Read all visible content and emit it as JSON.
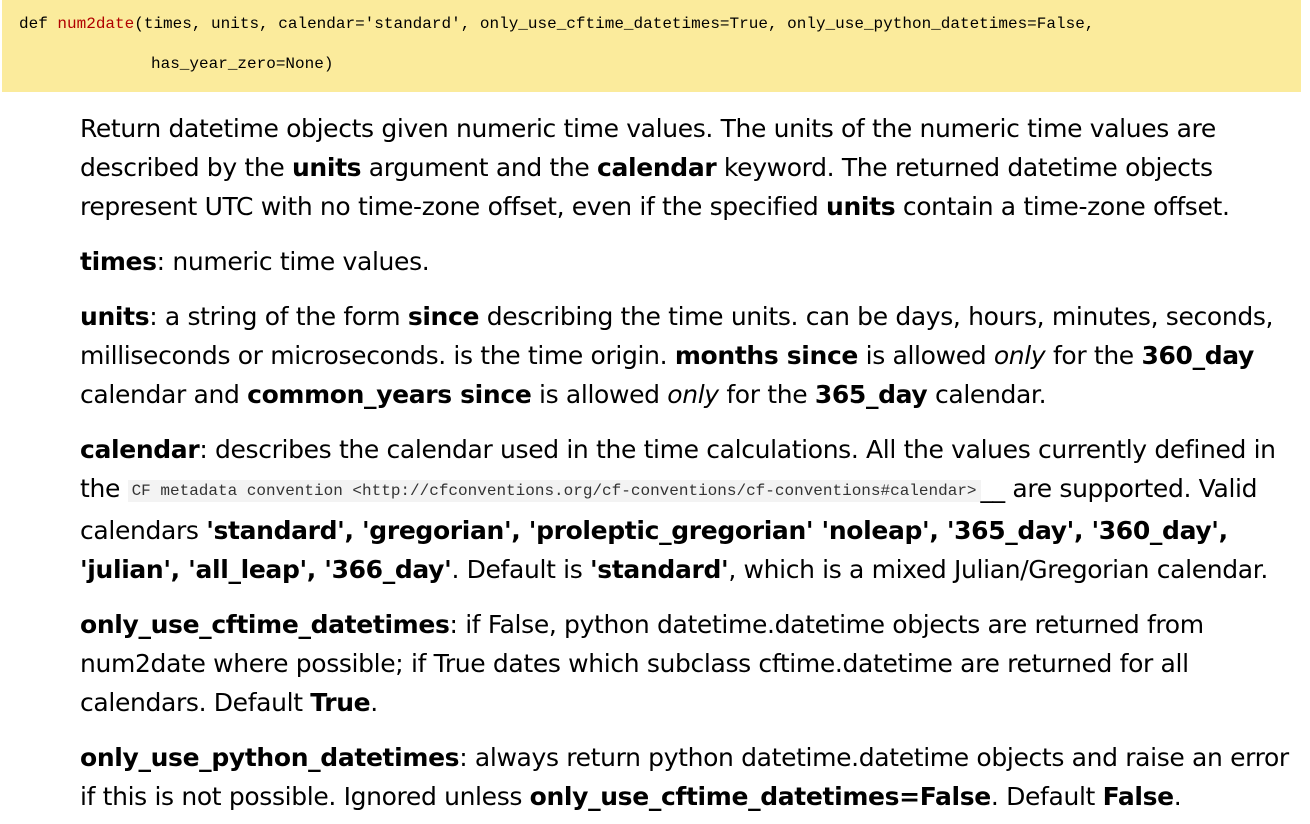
{
  "signature": {
    "keyword": "def",
    "name": "num2date",
    "params_line1": "(times, units, calendar='standard', only_use_cftime_datetimes=True, only_use_python_datetimes=False,",
    "params_line2": "has_year_zero=None)"
  },
  "intro": {
    "t1": "Return datetime objects given numeric time values. The units of the numeric time values are described by the ",
    "b1": "units",
    "t2": " argument and the ",
    "b2": "calendar",
    "t3": " keyword. The returned datetime objects represent UTC with no time-zone offset, even if the specified ",
    "b3": "units",
    "t4": " contain a time-zone offset."
  },
  "times": {
    "name": "times",
    "desc": ": numeric time values."
  },
  "units": {
    "name": "units",
    "t1": ": a string of the form ",
    "b1": "since",
    "t2": " describing the time units. can be days, hours, minutes, seconds, milliseconds or microseconds. is the time origin. ",
    "b2": "months since",
    "t3": " is allowed ",
    "i1": "only",
    "t4": " for the ",
    "b3": "360_day",
    "t5": " calendar and ",
    "b4": "common_years since",
    "t6": " is allowed ",
    "i2": "only",
    "t7": " for the ",
    "b5": "365_day",
    "t8": " calendar."
  },
  "calendar": {
    "name": "calendar",
    "t1": ": describes the calendar used in the time calculations. All the values currently defined in the ",
    "code": "CF metadata convention <http://cfconventions.org/cf-conventions/cf-conventions#calendar>",
    "t2": "__ are supported. Valid calendars ",
    "b1": "'standard', 'gregorian', 'proleptic_gregorian' 'noleap', '365_day', '360_day', 'julian', 'all_leap', '366_day'",
    "t3": ". Default is ",
    "b2": "'standard'",
    "t4": ", which is a mixed Julian/Gregorian calendar."
  },
  "only_cftime": {
    "name": "only_use_cftime_datetimes",
    "t1": ": if False, python datetime.datetime objects are returned from num2date where possible; if True dates which subclass cftime.datetime are returned for all calendars. Default ",
    "b1": "True",
    "t2": "."
  },
  "only_python": {
    "name": "only_use_python_datetimes",
    "t1": ": always return python datetime.datetime objects and raise an error if this is not possible. Ignored unless ",
    "b1": "only_use_cftime_datetimes=False",
    "t2": ". Default ",
    "b2": "False",
    "t3": "."
  }
}
